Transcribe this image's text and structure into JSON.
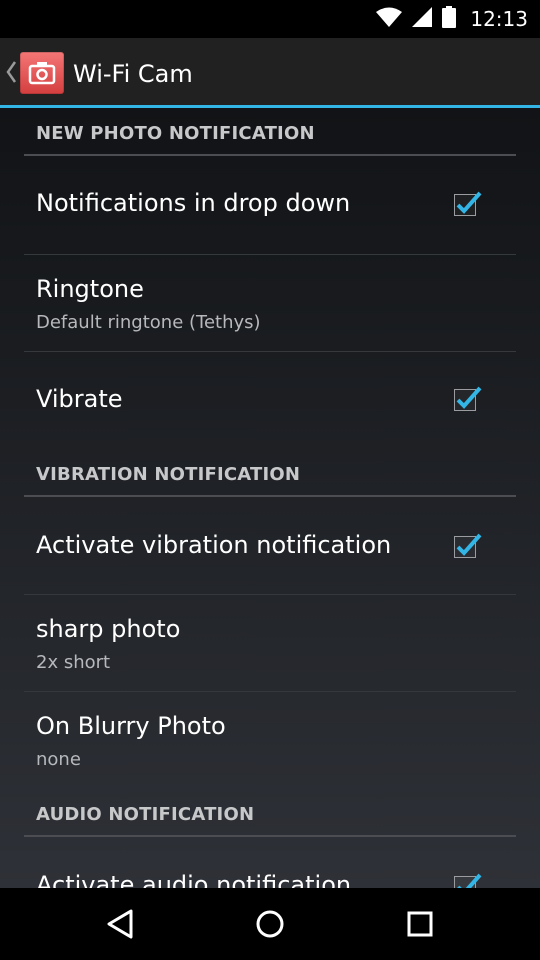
{
  "status_bar": {
    "time": "12:13",
    "icons": [
      "wifi-icon",
      "cell-signal-icon",
      "battery-icon"
    ]
  },
  "action_bar": {
    "title": "Wi-Fi Cam",
    "icon": "camera-icon",
    "accent_color": "#33b5e5"
  },
  "preferences": {
    "new_photo_header": "NEW PHOTO NOTIFICATION",
    "notifications_dropdown": {
      "title": "Notifications in drop down",
      "checked": true
    },
    "ringtone": {
      "title": "Ringtone",
      "summary": "Default ringtone (Tethys)"
    },
    "vibrate": {
      "title": "Vibrate",
      "checked": true
    },
    "vibration_header": "VIBRATION NOTIFICATION",
    "activate_vibration": {
      "title": "Activate vibration notification",
      "checked": true
    },
    "sharp_photo": {
      "title": "sharp photo",
      "summary": "2x short"
    },
    "blurry_photo": {
      "title": "On Blurry Photo",
      "summary": "none"
    },
    "audio_header": "AUDIO NOTIFICATION",
    "activate_audio": {
      "title": "Activate audio notification",
      "checked": true
    }
  },
  "navigation": {
    "buttons": [
      "back-icon",
      "home-icon",
      "recents-icon"
    ]
  }
}
